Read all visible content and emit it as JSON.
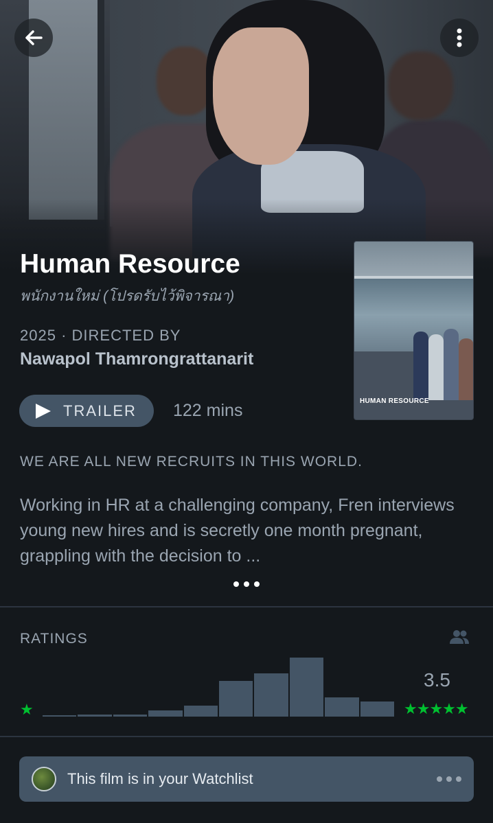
{
  "film": {
    "title": "Human Resource",
    "original_title": "พนักงานใหม่ (โปรดรับไว้พิจารณา)",
    "year": "2025",
    "directed_by_label": "· DIRECTED BY",
    "director": "Nawapol Thamrongrattanarit",
    "poster_title": "HUMAN RESOURCE",
    "runtime": "122 mins",
    "tagline": "WE ARE ALL NEW RECRUITS IN THIS WORLD.",
    "synopsis": "Working in HR at a challenging company, Fren interviews young new hires and is secretly one month pregnant, grappling with the decision to ..."
  },
  "actions": {
    "trailer_label": "TRAILER"
  },
  "ratings": {
    "label": "RATINGS",
    "average": "3.5",
    "low_star": "★",
    "high_stars": "★★★★★",
    "histogram": [
      0.02,
      0.03,
      0.04,
      0.11,
      0.19,
      0.61,
      0.73,
      1.0,
      0.32,
      0.26
    ]
  },
  "watchlist": {
    "text": "This film is in your Watchlist"
  },
  "icons": {
    "back": "arrow-left-icon",
    "more": "kebab-icon",
    "friends": "friends-icon",
    "play": "play-icon"
  },
  "colors": {
    "background": "#14181c",
    "accent_green": "#00c030",
    "button": "#445566",
    "muted_text": "#9aa5b1"
  }
}
